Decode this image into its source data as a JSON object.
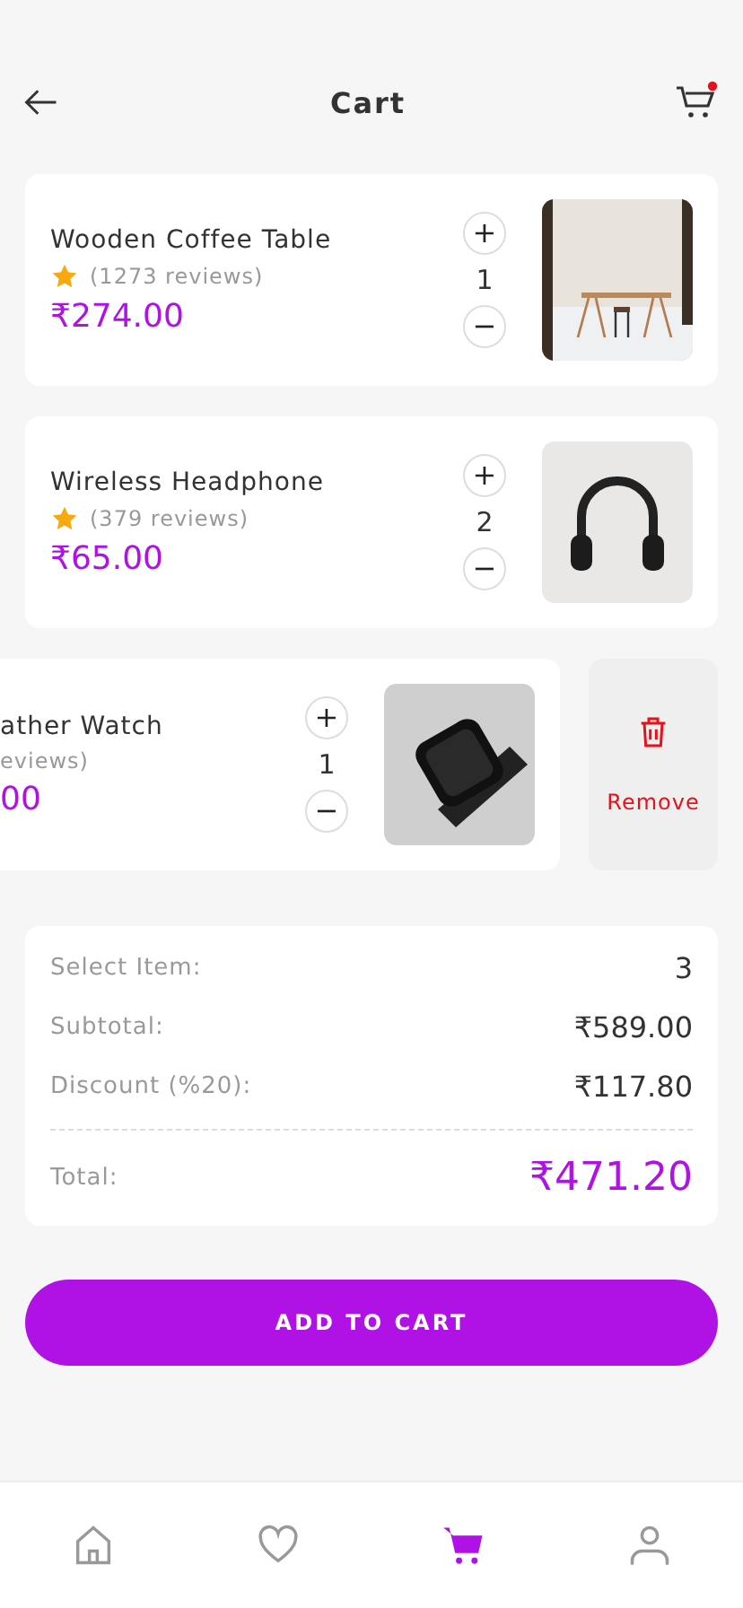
{
  "header": {
    "title": "Cart",
    "cart_badge": true
  },
  "items": [
    {
      "kind": "normal",
      "name": "Wooden Coffee Table",
      "reviews": "(1273 reviews)",
      "price": "₹274.00",
      "plus": "+",
      "qty": "1",
      "minus": "−"
    },
    {
      "kind": "normal",
      "name": "Wireless Headphone",
      "reviews": "(379 reviews)",
      "price": "₹65.00",
      "plus": "+",
      "qty": "2",
      "minus": "−"
    },
    {
      "kind": "swiped",
      "name": "ather Watch",
      "reviews": "eviews)",
      "price": "00",
      "plus": "+",
      "qty": "1",
      "minus": "−",
      "action": "Remove"
    }
  ],
  "summary": {
    "rows": [
      {
        "label": "Select Item:",
        "value": "3"
      },
      {
        "label": "Subtotal:",
        "value": "₹589.00"
      },
      {
        "label": "Discount (%20):",
        "value": "₹117.80"
      }
    ],
    "total_label": "Total:",
    "total_value": "₹471.20"
  },
  "button": "ADD TO CART",
  "nav": [
    {
      "selected": false
    },
    {
      "selected": false
    },
    {
      "selected": true
    },
    {
      "selected": false
    }
  ]
}
